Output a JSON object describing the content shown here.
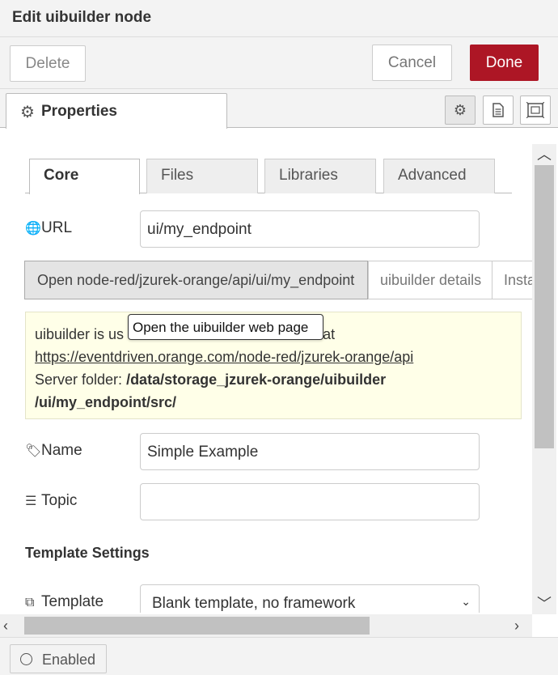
{
  "dialog": {
    "title": "Edit uibuilder node"
  },
  "toolbar": {
    "delete_label": "Delete",
    "cancel_label": "Cancel",
    "done_label": "Done",
    "done_color": "#AD1625"
  },
  "panel_tabs": {
    "properties_label": "Properties",
    "icons": [
      "gear-icon",
      "description-icon",
      "appearance-icon"
    ]
  },
  "inner_tabs": [
    "Core",
    "Files",
    "Libraries",
    "Advanced"
  ],
  "url": {
    "label": "URL",
    "value": "ui/my_endpoint"
  },
  "links": {
    "open_label": "Open node-red/jzurek-orange/api/ui/my_endpoint",
    "details_label": "uibuilder details",
    "instances_label": "Insta"
  },
  "info": {
    "line1_prefix": "uibuilder is us",
    "line1_suffix": "at",
    "url": "https://eventdriven.orange.com/node-red/jzurek-orange/api",
    "folder_label": "Server folder:",
    "folder_path_1": "/data/storage_jzurek-orange/uibuilder",
    "folder_path_2": "/ui/my_endpoint/src/"
  },
  "tooltip": "Open the uibuilder web page",
  "name": {
    "label": "Name",
    "value": "Simple Example"
  },
  "topic": {
    "label": "Topic",
    "value": ""
  },
  "template_settings": {
    "heading": "Template Settings",
    "template_label": "Template",
    "template_value": "Blank template, no framework"
  },
  "footer": {
    "enabled_label": "Enabled"
  }
}
